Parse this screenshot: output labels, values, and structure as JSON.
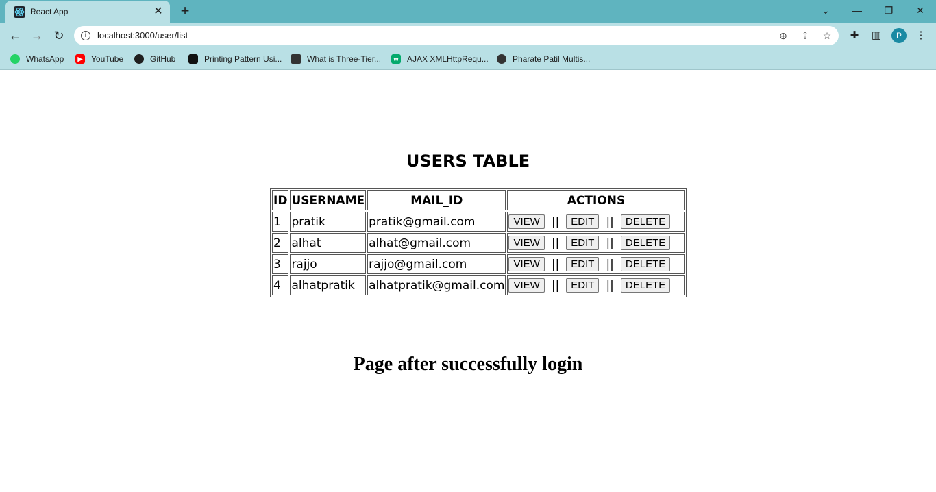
{
  "browser": {
    "tab": {
      "title": "React App",
      "favicon": "react-logo-icon"
    },
    "url": "localhost:3000/user/list",
    "profile_initial": "P",
    "bookmarks": [
      {
        "label": "WhatsApp",
        "icon": "whatsapp-icon",
        "color": "#25d366"
      },
      {
        "label": "YouTube",
        "icon": "youtube-icon",
        "color": "#ff0000"
      },
      {
        "label": "GitHub",
        "icon": "github-icon",
        "color": "#1f1f1f"
      },
      {
        "label": "Printing Pattern Usi...",
        "icon": "geeks-icon",
        "color": "#111111"
      },
      {
        "label": "What is Three-Tier...",
        "icon": "tier-icon",
        "color": "#333333"
      },
      {
        "label": "AJAX XMLHttpRequ...",
        "icon": "w3schools-icon",
        "color": "#04aa6d"
      },
      {
        "label": "Pharate Patil Multis...",
        "icon": "globe-icon",
        "color": "#333333"
      }
    ]
  },
  "page": {
    "heading": "USERS TABLE",
    "footer_heading": "Page after successfully login"
  },
  "users_table": {
    "headers": {
      "id": "ID",
      "username": "USERNAME",
      "mail": "MAIL_ID",
      "actions": "ACTIONS"
    },
    "rows": [
      {
        "id": "1",
        "username": "pratik",
        "mail": "pratik@gmail.com"
      },
      {
        "id": "2",
        "username": "alhat",
        "mail": "alhat@gmail.com"
      },
      {
        "id": "3",
        "username": "rajjo",
        "mail": "rajjo@gmail.com"
      },
      {
        "id": "4",
        "username": "alhatpratik",
        "mail": "alhatpratik@gmail.com"
      }
    ],
    "actions": {
      "view": "VIEW",
      "edit": "EDIT",
      "delete": "DELETE",
      "separator": "||"
    }
  }
}
